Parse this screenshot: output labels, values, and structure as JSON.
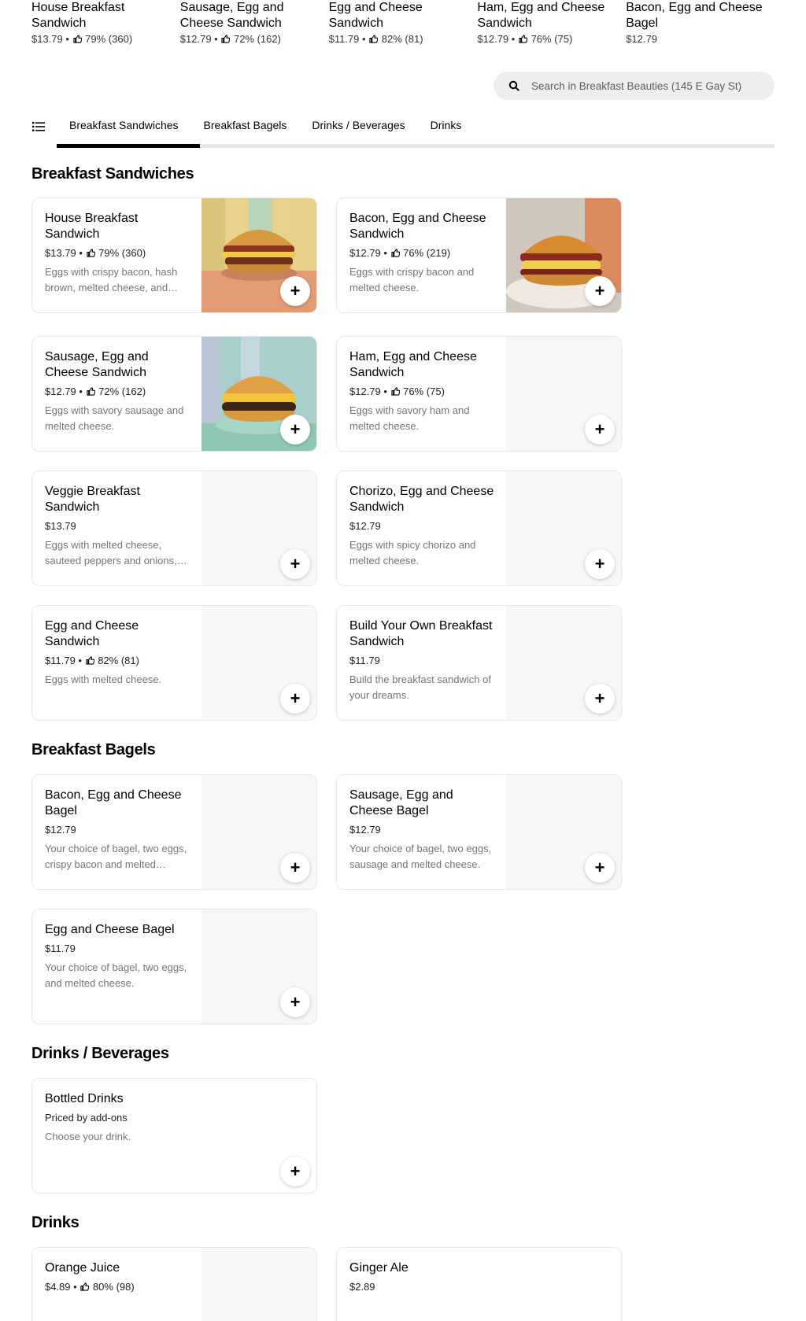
{
  "featured": [
    {
      "name": "House Breakfast Sandwich",
      "meta": "$13.79 • ",
      "rating": "79% (360)"
    },
    {
      "name": "Sausage, Egg and Cheese Sandwich",
      "meta": "$12.79 • ",
      "rating": "72% (162)"
    },
    {
      "name": "Egg and Cheese Sandwich",
      "meta": "$11.79 • ",
      "rating": "82% (81)"
    },
    {
      "name": "Ham, Egg and Cheese Sandwich",
      "meta": "$12.79 • ",
      "rating": "76% (75)"
    },
    {
      "name": "Bacon, Egg and Cheese Bagel",
      "meta": "$12.79",
      "rating": ""
    }
  ],
  "search": {
    "placeholder": "Search in Breakfast Beauties (145 E Gay St)",
    "icon": "search-icon"
  },
  "tabs": {
    "menu_icon": "list-icon",
    "items": [
      "Breakfast Sandwiches",
      "Breakfast Bagels",
      "Drinks / Beverages",
      "Drinks"
    ],
    "active": "Breakfast Sandwiches"
  },
  "sections": {
    "sandwiches": {
      "title": "Breakfast Sandwiches",
      "items": [
        {
          "name": "House Breakfast Sandwich",
          "price": "$13.79 • ",
          "rating": "79% (360)",
          "desc": "Eggs with crispy bacon, hash brown, melted cheese, and chipotle aioli on a toasted bun."
        },
        {
          "name": "Bacon, Egg and Cheese Sandwich",
          "price": "$12.79 • ",
          "rating": "76% (219)",
          "desc": "Eggs with crispy bacon and melted cheese."
        },
        {
          "name": "Sausage, Egg and Cheese Sandwich",
          "price": "$12.79 • ",
          "rating": "72% (162)",
          "desc": "Eggs with savory sausage and melted cheese."
        },
        {
          "name": "Ham, Egg and Cheese Sandwich",
          "price": "$12.79 • ",
          "rating": "76% (75)",
          "desc": "Eggs with savory ham and melted cheese."
        },
        {
          "name": "Veggie Breakfast Sandwich",
          "price": "$13.79",
          "rating": "",
          "desc": "Eggs with melted cheese, sauteed peppers and onions, and spinach."
        },
        {
          "name": "Chorizo, Egg and Cheese Sandwich",
          "price": "$12.79",
          "rating": "",
          "desc": "Eggs with spicy chorizo and melted cheese."
        },
        {
          "name": "Egg and Cheese Sandwich",
          "price": "$11.79 • ",
          "rating": "82% (81)",
          "desc": "Eggs with melted cheese."
        },
        {
          "name": "Build Your Own Breakfast Sandwich",
          "price": "$11.79",
          "rating": "",
          "desc": "Build the breakfast sandwich of your dreams."
        }
      ]
    },
    "bagels": {
      "title": "Breakfast Bagels",
      "items": [
        {
          "name": "Bacon, Egg and Cheese Bagel",
          "price": "$12.79",
          "rating": "",
          "desc": "Your choice of bagel, two eggs, crispy bacon and melted cheese."
        },
        {
          "name": "Sausage, Egg and Cheese Bagel",
          "price": "$12.79",
          "rating": "",
          "desc": "Your choice of bagel, two eggs, sausage and melted cheese."
        },
        {
          "name": "Egg and Cheese Bagel",
          "price": "$11.79",
          "rating": "",
          "desc": "Your choice of bagel, two eggs, and melted cheese."
        }
      ]
    },
    "beverages": {
      "title": "Drinks / Beverages",
      "items": [
        {
          "name": "Bottled Drinks",
          "price": "Priced by add-ons",
          "rating": "",
          "desc": "Choose your drink."
        }
      ]
    },
    "drinks": {
      "title": "Drinks",
      "items": [
        {
          "name": "Orange Juice",
          "price": "$4.89 • ",
          "rating": "80% (98)",
          "desc": ""
        },
        {
          "name": "Ginger Ale",
          "price": "$2.89",
          "rating": "",
          "desc": ""
        }
      ]
    }
  },
  "add_label": "+",
  "colors": {
    "accent": "#000000",
    "muted": "#757575",
    "tab_rail": "#e8e8e8",
    "search_bg": "#eeeeee"
  }
}
